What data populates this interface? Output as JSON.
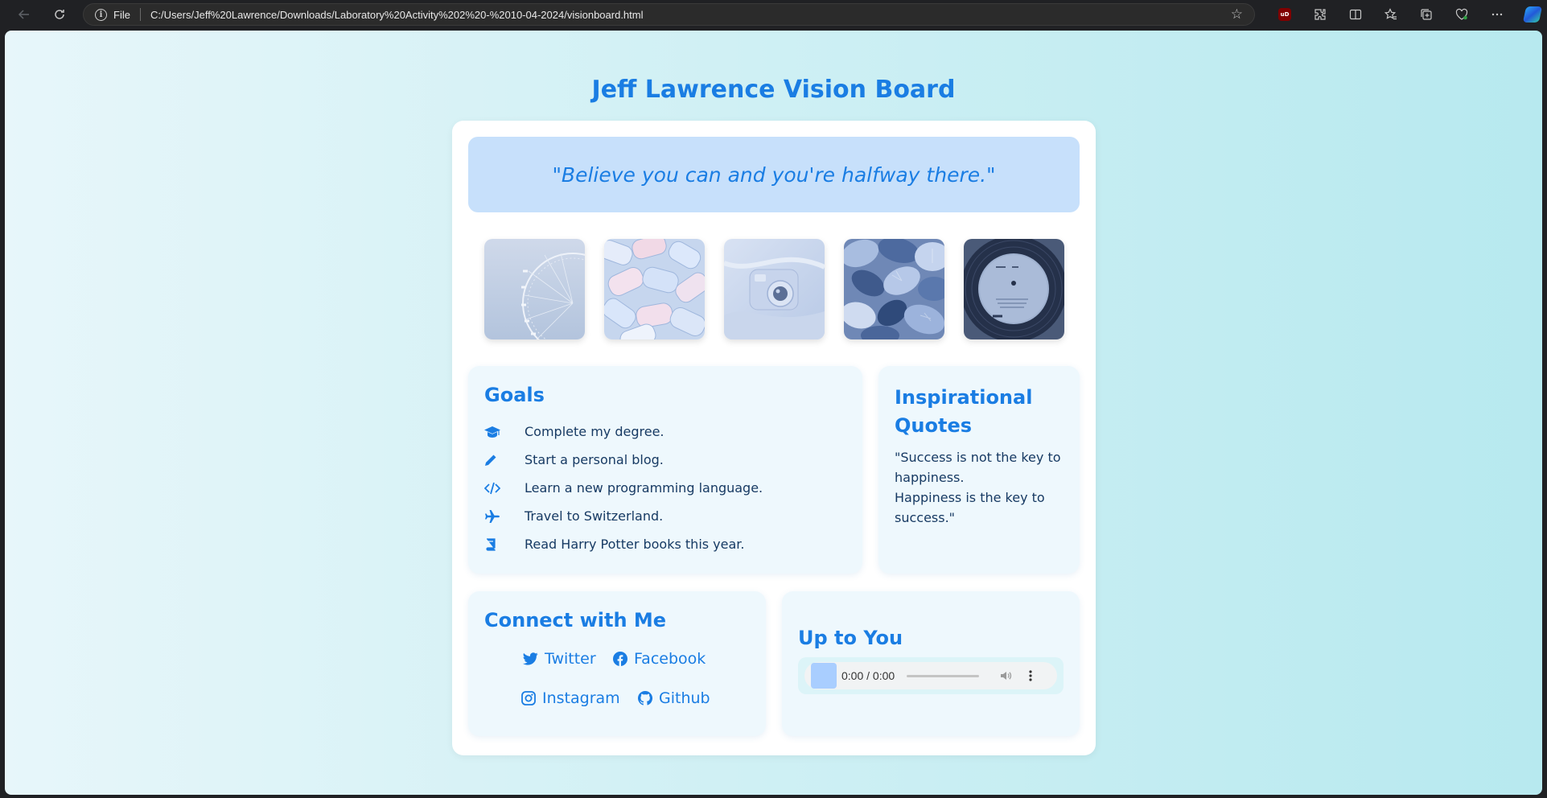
{
  "browser": {
    "file_label": "File",
    "url": "C:/Users/Jeff%20Lawrence/Downloads/Laboratory%20Activity%202%20-%2010-04-2024/visionboard.html",
    "extension_badge": "uD"
  },
  "page": {
    "title": "Jeff Lawrence Vision Board",
    "banner_quote": "\"Believe you can and you're halfway there.\""
  },
  "gallery": [
    {
      "subject": "ferris wheel",
      "icon": "ferris-wheel-photo"
    },
    {
      "subject": "marshmallows",
      "icon": "marshmallows-photo"
    },
    {
      "subject": "instant camera",
      "icon": "instant-camera-photo"
    },
    {
      "subject": "seashells",
      "icon": "seashells-photo"
    },
    {
      "subject": "vinyl record",
      "icon": "vinyl-record-photo"
    }
  ],
  "goals": {
    "title": "Goals",
    "items": [
      {
        "text": "Complete my degree.",
        "icon": "graduation-cap-icon"
      },
      {
        "text": "Start a personal blog.",
        "icon": "pencil-icon"
      },
      {
        "text": "Learn a new programming language.",
        "icon": "code-icon"
      },
      {
        "text": "Travel to Switzerland.",
        "icon": "plane-icon"
      },
      {
        "text": "Read Harry Potter books this year.",
        "icon": "book-icon"
      }
    ]
  },
  "quotes": {
    "title": "Inspirational Quotes",
    "line1": "\"Success is not the key to happiness.",
    "line2": "Happiness is the key to success.\""
  },
  "connect": {
    "title": "Connect with Me",
    "links": [
      {
        "label": "Twitter",
        "icon": "twitter-icon"
      },
      {
        "label": "Facebook",
        "icon": "facebook-icon"
      },
      {
        "label": "Instagram",
        "icon": "instagram-icon"
      },
      {
        "label": "Github",
        "icon": "github-icon"
      }
    ]
  },
  "audio": {
    "title": "Up to You",
    "time": "0:00 / 0:00"
  },
  "colors": {
    "accent": "#1a7de3",
    "text": "#173a63",
    "banner": "#c7e0fb",
    "panel": "#eef8fd"
  }
}
